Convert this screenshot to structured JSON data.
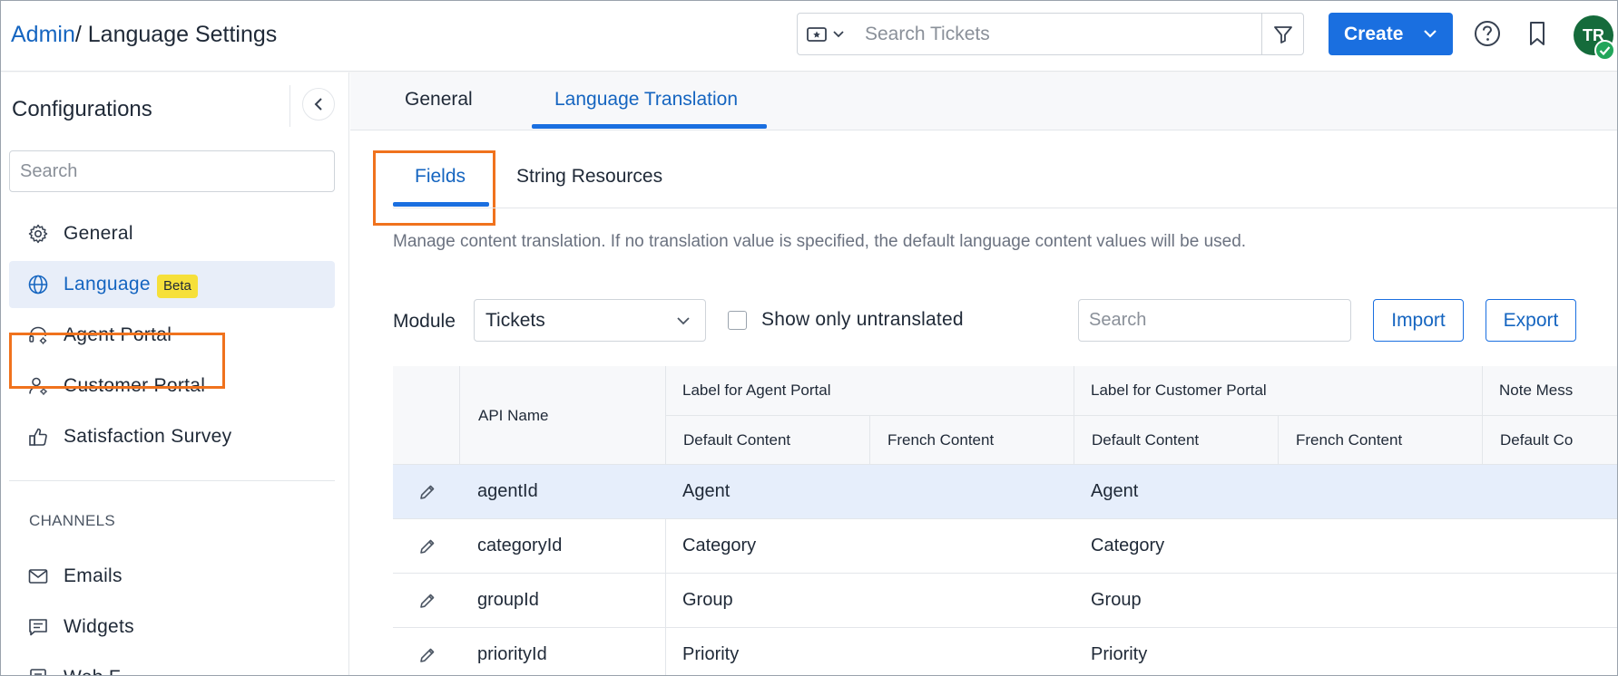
{
  "header": {
    "breadcrumb_root": "Admin",
    "breadcrumb_sep": "/ ",
    "breadcrumb_current": "Language Settings",
    "search_placeholder": "Search Tickets",
    "create_label": "Create",
    "avatar_initials": "TR",
    "brand_color": "#1a6fe0",
    "avatar_color": "#156b3b",
    "status_color": "#22a55a",
    "icons": [
      "ticket-icon",
      "chevron-down-icon",
      "filter-icon",
      "help-icon",
      "bookmark-icon",
      "check-icon"
    ]
  },
  "sidebar": {
    "title": "Configurations",
    "search_placeholder": "Search",
    "items": [
      {
        "label": "General",
        "icon": "gear-icon"
      },
      {
        "label": "Language",
        "icon": "globe-icon",
        "badge": "Beta",
        "active": true
      },
      {
        "label": "Agent Portal",
        "icon": "headset-gear-icon"
      },
      {
        "label": "Customer Portal",
        "icon": "user-gear-icon"
      },
      {
        "label": "Satisfaction Survey",
        "icon": "thumbs-up-icon"
      }
    ],
    "section_channels": "CHANNELS",
    "channel_items": [
      {
        "label": "Emails",
        "icon": "mail-icon"
      },
      {
        "label": "Widgets",
        "icon": "chat-widget-icon"
      },
      {
        "label": "Web F",
        "icon": "form-icon"
      }
    ],
    "highlight_color": "#f0721d"
  },
  "main": {
    "tabs": [
      {
        "label": "General",
        "active": false
      },
      {
        "label": "Language Translation",
        "active": true
      }
    ],
    "subtabs": [
      {
        "label": "Fields",
        "active": true
      },
      {
        "label": "String Resources",
        "active": false
      }
    ],
    "description": "Manage content translation. If no translation value is specified, the default language content values will be used.",
    "module_label": "Module",
    "module_value": "Tickets",
    "show_untranslated_label": "Show only untranslated",
    "show_untranslated_checked": false,
    "search_placeholder": "Search",
    "import_label": "Import",
    "export_label": "Export"
  },
  "table": {
    "col_api": "API Name",
    "group_agent": "Label for Agent Portal",
    "group_customer": "Label for Customer Portal",
    "group_note": "Note Mess",
    "sub_default": "Default Content",
    "sub_french": "French Content",
    "sub_default_cut": "Default Co",
    "rows": [
      {
        "api": "agentId",
        "agent_default": "Agent",
        "agent_french": "",
        "customer_default": "Agent",
        "customer_french": "",
        "selected": true
      },
      {
        "api": "categoryId",
        "agent_default": "Category",
        "agent_french": "",
        "customer_default": "Category",
        "customer_french": "",
        "selected": false
      },
      {
        "api": "groupId",
        "agent_default": "Group",
        "agent_french": "",
        "customer_default": "Group",
        "customer_french": "",
        "selected": false
      },
      {
        "api": "priorityId",
        "agent_default": "Priority",
        "agent_french": "",
        "customer_default": "Priority",
        "customer_french": "",
        "selected": false
      }
    ]
  }
}
